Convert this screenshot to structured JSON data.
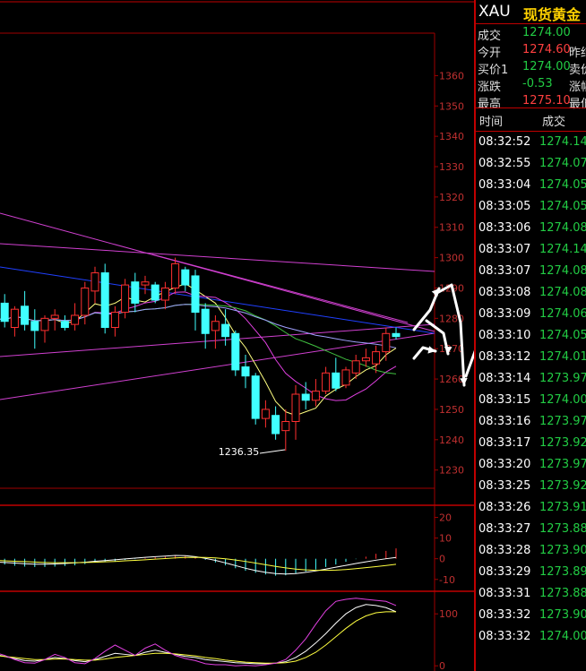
{
  "instrument": {
    "symbol": "XAU",
    "name": "现货黄金"
  },
  "quote": [
    {
      "label": "成交",
      "value": "1274.00",
      "color": "#22cc44",
      "extra": ""
    },
    {
      "label": "今开",
      "value": "1274.60",
      "color": "#ff4040",
      "extra": "昨结"
    },
    {
      "label": "买价1",
      "value": "1274.00",
      "color": "#22cc44",
      "extra": "卖价"
    },
    {
      "label": "涨跌",
      "value": "-0.53",
      "color": "#22cc44",
      "extra": "涨幅"
    },
    {
      "label": "最高",
      "value": "1275.10",
      "color": "#ff4040",
      "extra": "最低"
    }
  ],
  "ticks_header": {
    "time": "时间",
    "price": "成交"
  },
  "ticks": [
    {
      "time": "08:32:52",
      "price": "1274.14"
    },
    {
      "time": "08:32:55",
      "price": "1274.07"
    },
    {
      "time": "08:33:04",
      "price": "1274.05"
    },
    {
      "time": "08:33:05",
      "price": "1274.05"
    },
    {
      "time": "08:33:06",
      "price": "1274.08"
    },
    {
      "time": "08:33:07",
      "price": "1274.14"
    },
    {
      "time": "08:33:07",
      "price": "1274.08"
    },
    {
      "time": "08:33:08",
      "price": "1274.08"
    },
    {
      "time": "08:33:09",
      "price": "1274.06"
    },
    {
      "time": "08:33:10",
      "price": "1274.05"
    },
    {
      "time": "08:33:12",
      "price": "1274.01"
    },
    {
      "time": "08:33:14",
      "price": "1273.97"
    },
    {
      "time": "08:33:15",
      "price": "1274.00"
    },
    {
      "time": "08:33:16",
      "price": "1273.97"
    },
    {
      "time": "08:33:17",
      "price": "1273.92"
    },
    {
      "time": "08:33:20",
      "price": "1273.97"
    },
    {
      "time": "08:33:25",
      "price": "1273.92"
    },
    {
      "time": "08:33:26",
      "price": "1273.91"
    },
    {
      "time": "08:33:27",
      "price": "1273.88"
    },
    {
      "time": "08:33:28",
      "price": "1273.90"
    },
    {
      "time": "08:33:29",
      "price": "1273.89"
    },
    {
      "time": "08:33:31",
      "price": "1273.88"
    },
    {
      "time": "08:33:32",
      "price": "1273.90"
    },
    {
      "time": "08:33:32",
      "price": "1274.00"
    }
  ],
  "chart_data": {
    "type": "candlestick",
    "price_axis": {
      "ticks": [
        1230,
        1240,
        1250,
        1260,
        1270,
        1280,
        1290,
        1300,
        1310,
        1320,
        1330,
        1340,
        1350,
        1360
      ],
      "range": [
        1224,
        1374
      ]
    },
    "low_annotation": "1236.35",
    "candles": [
      {
        "o": 1282,
        "h": 1287,
        "l": 1275,
        "c": 1280
      },
      {
        "o": 1285,
        "h": 1288,
        "l": 1277,
        "c": 1279
      },
      {
        "o": 1277,
        "h": 1284,
        "l": 1274,
        "c": 1283
      },
      {
        "o": 1284,
        "h": 1289,
        "l": 1276,
        "c": 1278
      },
      {
        "o": 1279,
        "h": 1283,
        "l": 1270,
        "c": 1276
      },
      {
        "o": 1276,
        "h": 1281,
        "l": 1272,
        "c": 1280
      },
      {
        "o": 1280,
        "h": 1283,
        "l": 1276,
        "c": 1281
      },
      {
        "o": 1279,
        "h": 1281,
        "l": 1276,
        "c": 1277
      },
      {
        "o": 1278,
        "h": 1285,
        "l": 1276,
        "c": 1281
      },
      {
        "o": 1281,
        "h": 1292,
        "l": 1278,
        "c": 1290
      },
      {
        "o": 1289,
        "h": 1297,
        "l": 1285,
        "c": 1295
      },
      {
        "o": 1295,
        "h": 1298,
        "l": 1275,
        "c": 1277
      },
      {
        "o": 1277,
        "h": 1284,
        "l": 1274,
        "c": 1282
      },
      {
        "o": 1282,
        "h": 1293,
        "l": 1280,
        "c": 1291
      },
      {
        "o": 1292,
        "h": 1295,
        "l": 1282,
        "c": 1285
      },
      {
        "o": 1291,
        "h": 1294,
        "l": 1288,
        "c": 1292
      },
      {
        "o": 1291,
        "h": 1292,
        "l": 1285,
        "c": 1286
      },
      {
        "o": 1286,
        "h": 1292,
        "l": 1283,
        "c": 1290
      },
      {
        "o": 1290,
        "h": 1300,
        "l": 1288,
        "c": 1298
      },
      {
        "o": 1296,
        "h": 1297,
        "l": 1289,
        "c": 1291
      },
      {
        "o": 1294,
        "h": 1296,
        "l": 1276,
        "c": 1282
      },
      {
        "o": 1283,
        "h": 1285,
        "l": 1270,
        "c": 1275
      },
      {
        "o": 1276,
        "h": 1281,
        "l": 1270,
        "c": 1279
      },
      {
        "o": 1278,
        "h": 1283,
        "l": 1271,
        "c": 1274
      },
      {
        "o": 1275,
        "h": 1276,
        "l": 1261,
        "c": 1263
      },
      {
        "o": 1264,
        "h": 1268,
        "l": 1257,
        "c": 1261
      },
      {
        "o": 1261,
        "h": 1262,
        "l": 1245,
        "c": 1247
      },
      {
        "o": 1247,
        "h": 1253,
        "l": 1244,
        "c": 1250
      },
      {
        "o": 1248,
        "h": 1251,
        "l": 1240,
        "c": 1242
      },
      {
        "o": 1243,
        "h": 1250,
        "l": 1236.35,
        "c": 1246
      },
      {
        "o": 1246,
        "h": 1258,
        "l": 1240,
        "c": 1255
      },
      {
        "o": 1255,
        "h": 1259,
        "l": 1250,
        "c": 1253
      },
      {
        "o": 1253,
        "h": 1260,
        "l": 1251,
        "c": 1256
      },
      {
        "o": 1256,
        "h": 1264,
        "l": 1255,
        "c": 1262
      },
      {
        "o": 1262,
        "h": 1267,
        "l": 1256,
        "c": 1257
      },
      {
        "o": 1258,
        "h": 1264,
        "l": 1257,
        "c": 1263
      },
      {
        "o": 1262,
        "h": 1268,
        "l": 1260,
        "c": 1266
      },
      {
        "o": 1266,
        "h": 1270,
        "l": 1264,
        "c": 1267
      },
      {
        "o": 1265,
        "h": 1271,
        "l": 1262,
        "c": 1269
      },
      {
        "o": 1269,
        "h": 1277,
        "l": 1266,
        "c": 1275
      },
      {
        "o": 1275,
        "h": 1277,
        "l": 1273,
        "c": 1274
      }
    ],
    "macd_axis": {
      "ticks": [
        -10,
        0,
        10,
        20
      ],
      "range": [
        -14,
        25
      ]
    },
    "macd_hist": [
      -2.2,
      -2.8,
      -3.4,
      -3.8,
      -4,
      -4,
      -3.8,
      -3.5,
      -3.2,
      -2.6,
      -1.8,
      -1.6,
      -1.2,
      -0.6,
      -0.2,
      0.4,
      0.8,
      1.1,
      1.6,
      1.4,
      0.6,
      -0.5,
      -1.8,
      -3.2,
      -4.6,
      -5.8,
      -6.8,
      -7.6,
      -8.2,
      -8,
      -7.2,
      -6.2,
      -5.2,
      -4,
      -2.8,
      -1.5,
      -0.2,
      1,
      2.4,
      3.8,
      5
    ],
    "macd_line": [
      -1.6,
      -1.8,
      -2.1,
      -2.4,
      -2.6,
      -2.6,
      -2.5,
      -2.3,
      -2,
      -1.7,
      -1.2,
      -0.9,
      -0.5,
      -0.1,
      0.3,
      0.7,
      1,
      1.3,
      1.6,
      1.5,
      1,
      0.2,
      -0.8,
      -2,
      -3.3,
      -4.6,
      -5.7,
      -6.6,
      -7.2,
      -7.4,
      -7.2,
      -6.6,
      -5.9,
      -5,
      -4.1,
      -3.2,
      -2.3,
      -1.5,
      -0.7,
      0,
      0.6
    ],
    "signal_line": [
      -0.8,
      -1,
      -1.2,
      -1.4,
      -1.6,
      -1.8,
      -1.9,
      -1.9,
      -1.9,
      -1.8,
      -1.7,
      -1.5,
      -1.3,
      -1,
      -0.8,
      -0.5,
      -0.2,
      0.1,
      0.4,
      0.6,
      0.7,
      0.6,
      0.4,
      0,
      -0.6,
      -1.3,
      -2.1,
      -2.9,
      -3.7,
      -4.4,
      -5,
      -5.4,
      -5.6,
      -5.6,
      -5.5,
      -5.2,
      -4.8,
      -4.3,
      -3.8,
      -3.3,
      -2.7
    ],
    "osc_axis": {
      "ticks": [
        0,
        100
      ],
      "range": [
        -10,
        140
      ]
    },
    "osc_k": [
      22,
      18,
      14,
      10,
      9,
      12,
      16,
      14,
      10,
      8,
      12,
      18,
      24,
      22,
      20,
      26,
      30,
      26,
      22,
      18,
      16,
      12,
      10,
      8,
      6,
      5,
      4,
      4,
      5,
      8,
      16,
      28,
      44,
      62,
      82,
      100,
      112,
      118,
      116,
      112,
      104
    ],
    "osc_d": [
      20,
      18,
      16,
      14,
      12,
      12,
      13,
      13,
      12,
      11,
      11,
      13,
      16,
      18,
      20,
      22,
      24,
      24,
      23,
      21,
      19,
      16,
      14,
      11,
      9,
      7,
      6,
      5,
      5,
      6,
      9,
      16,
      26,
      40,
      56,
      72,
      86,
      96,
      102,
      104,
      104
    ],
    "osc_j": [
      26,
      20,
      12,
      6,
      5,
      12,
      22,
      16,
      6,
      4,
      14,
      28,
      40,
      30,
      20,
      34,
      42,
      30,
      20,
      14,
      10,
      4,
      2,
      2,
      0,
      1,
      0,
      2,
      5,
      12,
      30,
      52,
      80,
      106,
      124,
      128,
      130,
      128,
      126,
      124,
      116
    ]
  }
}
